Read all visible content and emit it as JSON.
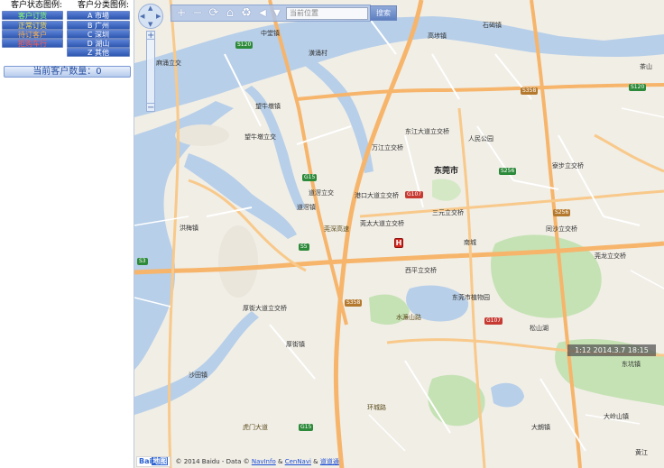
{
  "legend": {
    "status_title": "客户状态图例:",
    "category_title": "客户分类图例:",
    "status_items": [
      {
        "label": "客户订货",
        "color": "#8bff6b"
      },
      {
        "label": "正常订货",
        "color": "#ffe04a"
      },
      {
        "label": "待订客户",
        "color": "#ffb04a"
      },
      {
        "label": "拒购车行",
        "color": "#ff5a4a"
      }
    ],
    "category_items": [
      {
        "label": "A 市場"
      },
      {
        "label": "B 广州"
      },
      {
        "label": "C 深圳"
      },
      {
        "label": "D 湖山"
      },
      {
        "label": "Z 其他"
      }
    ]
  },
  "count_label": "当前客户数量：0",
  "toolbar": {
    "search_placeholder": "当前位置",
    "search_button": "搜索",
    "icons": [
      "plus-icon",
      "minus-icon",
      "refresh-icon",
      "home-icon",
      "recycle-icon",
      "pan-icon",
      "dropdown-icon"
    ]
  },
  "marker": {
    "label": "H"
  },
  "datetime": "1:12 2014.3.7 18:15",
  "copyright": {
    "logo_main": "Bai",
    "logo_sub": "地图",
    "text": "© 2014 Baidu - Data ©",
    "link1": "NavInfo",
    "amp1": "&",
    "link2": "CenNavi",
    "amp2": "&",
    "link3": "道道通"
  },
  "map_labels": [
    {
      "t": "中堂镇",
      "cls": ""
    },
    {
      "t": "潢涌村",
      "cls": ""
    },
    {
      "t": "高埗镇",
      "cls": ""
    },
    {
      "t": "石碣镇",
      "cls": ""
    },
    {
      "t": "望牛墩镇",
      "cls": ""
    },
    {
      "t": "望牛墩立交",
      "cls": ""
    },
    {
      "t": "万江立交桥",
      "cls": ""
    },
    {
      "t": "东莞市",
      "cls": "city"
    },
    {
      "t": "道滘立交",
      "cls": ""
    },
    {
      "t": "道滘镇",
      "cls": ""
    },
    {
      "t": "港口大道立交桥",
      "cls": ""
    },
    {
      "t": "莞太大道立交桥",
      "cls": ""
    },
    {
      "t": "东江大道立交桥",
      "cls": ""
    },
    {
      "t": "人民公园",
      "cls": ""
    },
    {
      "t": "三元立交桥",
      "cls": ""
    },
    {
      "t": "南城",
      "cls": ""
    },
    {
      "t": "洪梅镇",
      "cls": ""
    },
    {
      "t": "麻涌立交",
      "cls": ""
    },
    {
      "t": "厚街大道立交桥",
      "cls": ""
    },
    {
      "t": "厚街镇",
      "cls": ""
    },
    {
      "t": "沙田镇",
      "cls": ""
    },
    {
      "t": "虎门大道",
      "cls": ""
    },
    {
      "t": "西平立交桥",
      "cls": ""
    },
    {
      "t": "东莞市植物园",
      "cls": ""
    },
    {
      "t": "同沙立交桥",
      "cls": ""
    },
    {
      "t": "寮步立交桥",
      "cls": ""
    },
    {
      "t": "莞龙立交桥",
      "cls": ""
    },
    {
      "t": "大岭山镇",
      "cls": ""
    },
    {
      "t": "环城路",
      "cls": ""
    },
    {
      "t": "松山湖",
      "cls": ""
    },
    {
      "t": "水濂山路",
      "cls": ""
    },
    {
      "t": "莞深高速",
      "cls": ""
    },
    {
      "t": "黄江",
      "cls": ""
    },
    {
      "t": "东坑镇",
      "cls": ""
    },
    {
      "t": "大朗镇",
      "cls": ""
    },
    {
      "t": "茶山",
      "cls": ""
    }
  ],
  "road_shields": [
    "S120",
    "G15",
    "S256",
    "G107",
    "S3",
    "S5",
    "S358",
    "G15",
    "G107",
    "S358",
    "S120",
    "S256"
  ]
}
